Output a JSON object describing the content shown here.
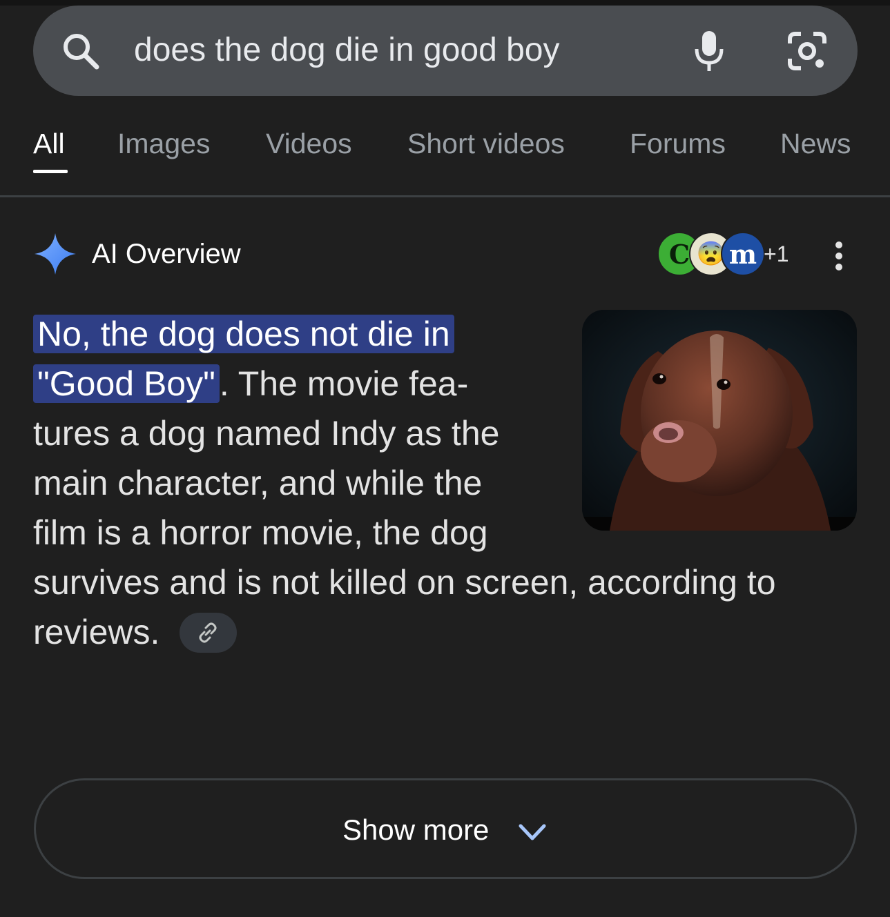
{
  "search": {
    "query": "does the dog die in good boy"
  },
  "tabs": [
    {
      "label": "All",
      "active": true
    },
    {
      "label": "Images"
    },
    {
      "label": "Videos"
    },
    {
      "label": "Short videos"
    },
    {
      "label": "Forums"
    },
    {
      "label": "News"
    }
  ],
  "ai_overview": {
    "title": "AI Overview",
    "sources": [
      {
        "label": "C",
        "color": "#3cae35"
      },
      {
        "label": "😨",
        "color": "#e8e4d0"
      },
      {
        "label": "m",
        "color": "#1e4fa5"
      }
    ],
    "extra_sources": "+1",
    "highlight_line1": "No, the dog does not die in",
    "highlight_line2": "\"Good Boy\"",
    "line2_rest": ". The movie fea-",
    "line3": "tures a dog named Indy as the",
    "line4": "main character, and while the",
    "line5": "film is a horror movie, the dog",
    "line6": "survives and is not killed on screen, according to",
    "line7": "reviews.",
    "link_icon": "link-icon",
    "image_subject": "dog-portrait"
  },
  "show_more": {
    "label": "Show more",
    "icon": "chevron-down-icon"
  },
  "colors": {
    "background": "#1f1f1f",
    "search_bar": "#4a4d51",
    "highlight": "#2f3f86",
    "sparkle": "#4c8df6"
  }
}
